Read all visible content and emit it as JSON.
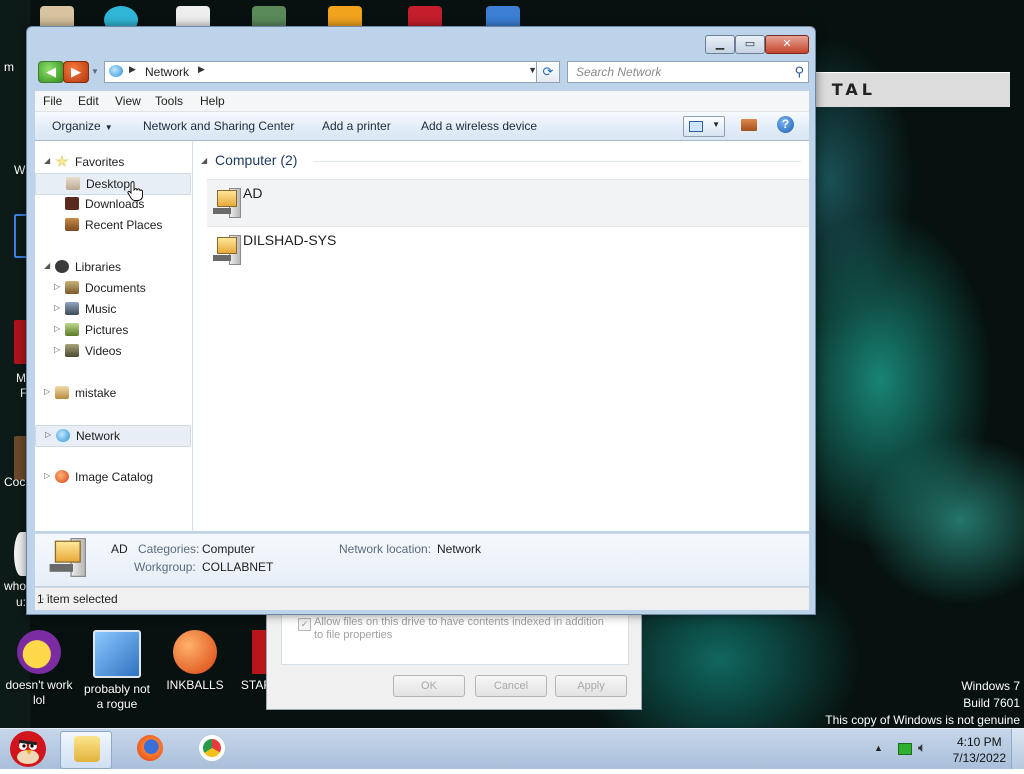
{
  "explorer": {
    "address": {
      "crumb": "Network"
    },
    "search": {
      "placeholder": "Search Network"
    },
    "menu": [
      "File",
      "Edit",
      "View",
      "Tools",
      "Help"
    ],
    "commands": {
      "organize": "Organize",
      "network_center": "Network and Sharing Center",
      "add_printer": "Add a printer",
      "add_wireless": "Add a wireless device"
    },
    "nav": {
      "favorites": "Favorites",
      "desktop": "Desktop",
      "downloads": "Downloads",
      "recent": "Recent Places",
      "libraries": "Libraries",
      "documents": "Documents",
      "music": "Music",
      "pictures": "Pictures",
      "videos": "Videos",
      "mistake": "mistake",
      "network": "Network",
      "image_catalog": "Image Catalog"
    },
    "content": {
      "group_header": "Computer (2)",
      "items": [
        "AD",
        "DILSHAD-SYS"
      ]
    },
    "details": {
      "name": "AD",
      "categories_label": "Categories:",
      "categories_value": "Computer",
      "workgroup_label": "Workgroup:",
      "workgroup_value": "COLLABNET",
      "location_label": "Network location:",
      "location_value": "Network"
    },
    "status": "1 item selected"
  },
  "desktop_icons": {
    "yahoo": "doesn't work lol",
    "rogue": "probably not a rogue",
    "inkballs": "INKBALLS",
    "star": "STAR"
  },
  "left_fragments": [
    "m",
    "W",
    "M",
    "F",
    "Coc",
    "who",
    "u:"
  ],
  "background_dialog": {
    "checkbox_label": "Allow files on this drive to have contents indexed in addition to file properties",
    "ok": "OK",
    "cancel": "Cancel",
    "apply": "Apply"
  },
  "top_banner_text": "TAL",
  "watermark": {
    "line1": "Windows 7",
    "line2": "Build 7601",
    "line3": "This copy of Windows is not genuine"
  },
  "clock": {
    "time": "4:10 PM",
    "date": "7/13/2022"
  },
  "colors": {
    "accent": "#2a8fd6",
    "taskbar": "#b8cbe2",
    "selection": "#e8eef5"
  }
}
